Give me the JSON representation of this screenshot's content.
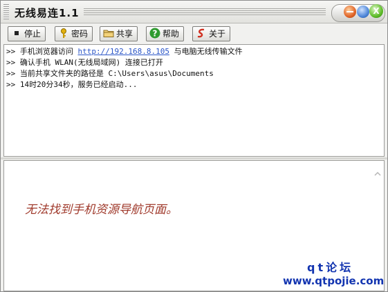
{
  "window": {
    "title": "无线易连1.1"
  },
  "titlebar_controls": {
    "close_glyph": "X"
  },
  "toolbar": {
    "stop": {
      "label": "停止",
      "icon": "stop-square-icon"
    },
    "password": {
      "label": "密码",
      "icon": "key-icon"
    },
    "share": {
      "label": "共享",
      "icon": "folder-icon"
    },
    "help": {
      "label": "帮助",
      "icon": "help-question-icon"
    },
    "about": {
      "label": "关于",
      "icon": "about-info-icon"
    }
  },
  "log": {
    "prompt": ">>",
    "lines": [
      {
        "text": "手机浏览器访问 ",
        "url": "http://192.168.8.105",
        "suffix": " 与电脑无线传输文件"
      },
      {
        "text": "确认手机 WLAN(无线局域网) 连接已打开"
      },
      {
        "text": "当前共享文件夹的路径是 C:\\Users\\asus\\Documents"
      },
      {
        "text": "14时20分34秒，服务已经启动..."
      }
    ]
  },
  "browser": {
    "message": "无法找到手机资源导航页面。"
  },
  "watermark": {
    "line1": "qt论坛",
    "line2": "www.qtpojie.com"
  },
  "colors": {
    "link": "#2a55c7",
    "message": "#a03a2c",
    "watermark": "#1234b0"
  }
}
